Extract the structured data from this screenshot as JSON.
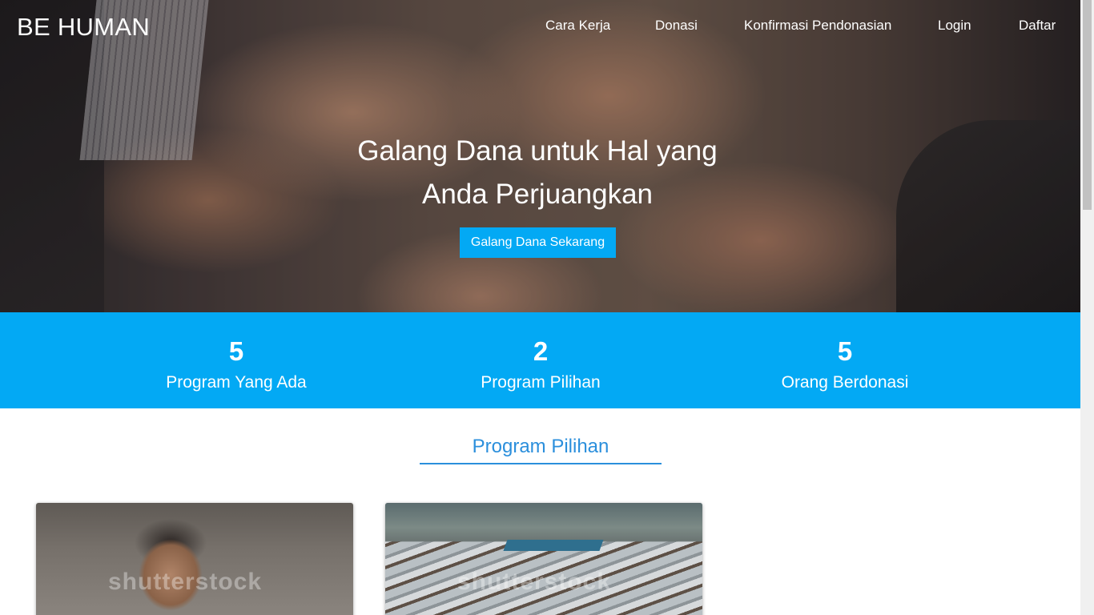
{
  "brand": "BE HUMAN",
  "nav": {
    "items": [
      "Cara Kerja",
      "Donasi",
      "Konfirmasi Pendonasian",
      "Login",
      "Daftar"
    ]
  },
  "hero": {
    "title_line1": "Galang Dana untuk Hal yang",
    "title_line2": "Anda Perjuangkan",
    "cta": "Galang Dana Sekarang"
  },
  "stats": [
    {
      "number": "5",
      "label": "Program Yang Ada"
    },
    {
      "number": "2",
      "label": "Program Pilihan"
    },
    {
      "number": "5",
      "label": "Orang Berdonasi"
    }
  ],
  "section": {
    "title": "Program Pilihan"
  },
  "cards": [
    {
      "watermark": "shutterstock"
    },
    {
      "watermark": "shutterstock"
    }
  ],
  "colors": {
    "accent": "#03a9f4",
    "section_title": "#2b8fdc"
  }
}
